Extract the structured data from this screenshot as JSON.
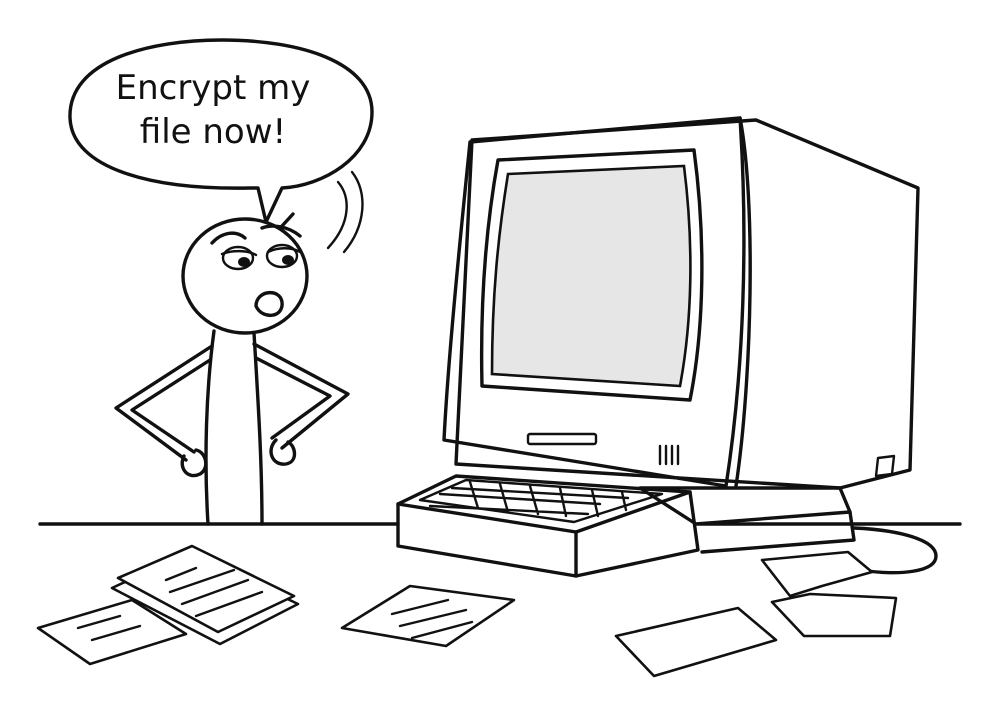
{
  "speech_bubble": {
    "line1": "Encrypt my",
    "line2": "file now!"
  },
  "colors": {
    "ink": "#111111",
    "screen": "#e6e6e6",
    "background": "#ffffff"
  }
}
